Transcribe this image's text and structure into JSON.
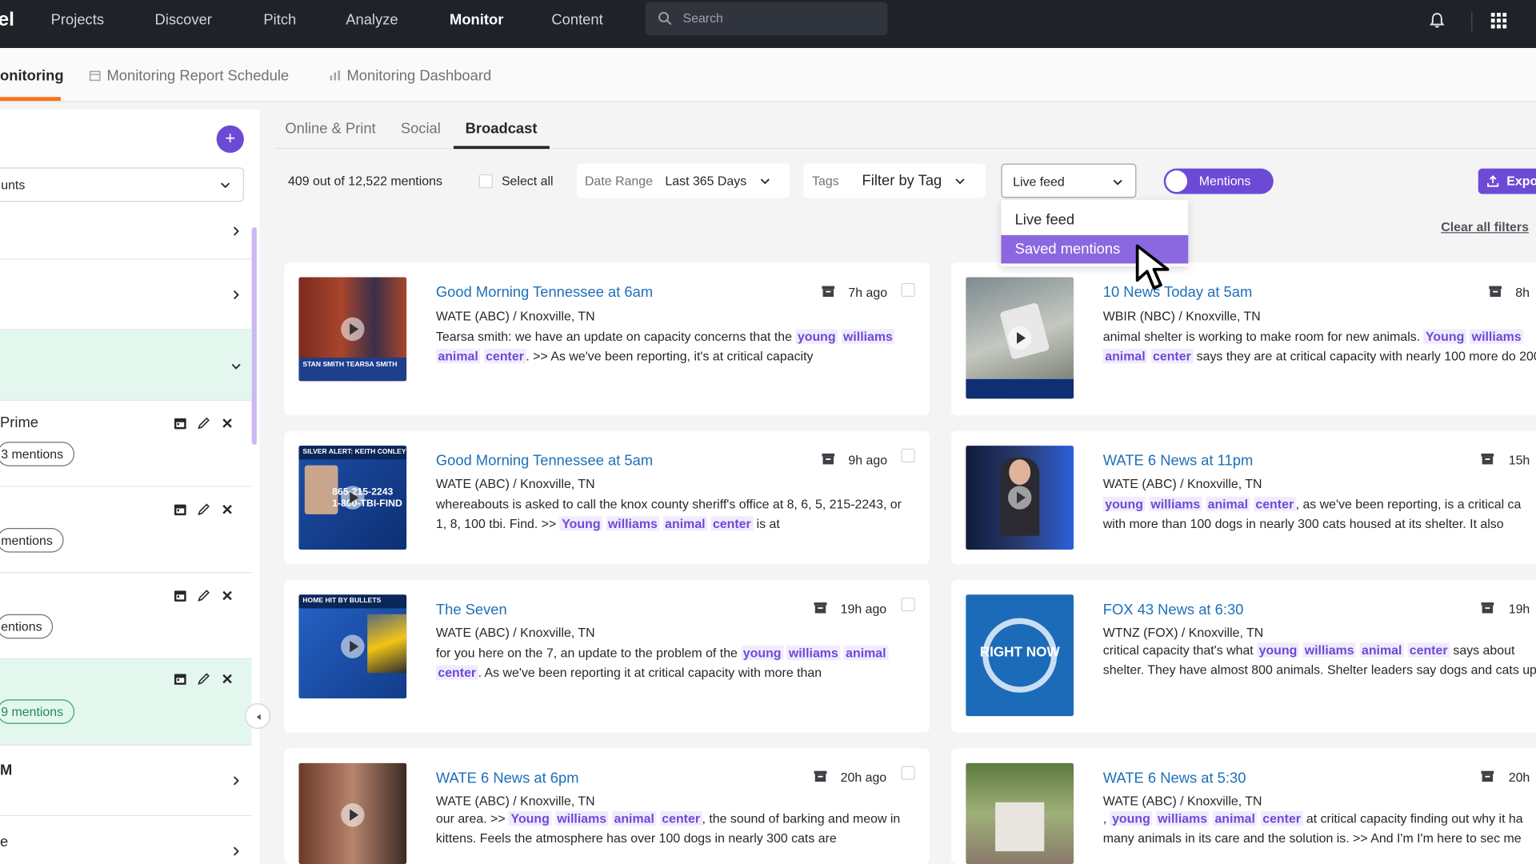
{
  "nav": {
    "logo": "el",
    "items": [
      "Projects",
      "Discover",
      "Pitch",
      "Analyze",
      "Monitor",
      "Content"
    ],
    "search_placeholder": "Search"
  },
  "subnav": {
    "tabs": [
      "onitoring",
      "Monitoring Report Schedule",
      "Monitoring Dashboard"
    ]
  },
  "sidebar": {
    "select_value": "unts",
    "row_prime": "Prime",
    "row_m": "M",
    "row_e": "e",
    "pills": [
      "3 mentions",
      "mentions",
      "entions",
      "9 mentions"
    ]
  },
  "content_tabs": [
    "Online & Print",
    "Social",
    "Broadcast"
  ],
  "filters": {
    "count": "409 out of 12,522 mentions",
    "select_all": "Select all",
    "date_label": "Date Range",
    "date_value": "Last 365 Days",
    "tags_label": "Tags",
    "tags_value": "Filter by Tag",
    "feed_value": "Live feed",
    "toggle_label": "Mentions",
    "export_label": "Expo",
    "clear": "Clear all filters"
  },
  "dropdown": {
    "options": [
      "Live feed",
      "Saved mentions"
    ],
    "selected": "Saved mentions"
  },
  "cards_left": [
    {
      "title": "Good Morning Tennessee at 6am",
      "time": "7h ago",
      "source": "WATE (ABC) / Knoxville, TN",
      "pre": "Tearsa smith: we have an update on capacity concerns that the ",
      "kw": [
        "young",
        "williams",
        "animal",
        "center"
      ],
      "post": ". >> As we've been reporting, it's at critical capacity",
      "thumb_caption": "STAN SMITH   TEARSA SMITH"
    },
    {
      "title": "Good Morning Tennessee at 5am",
      "time": "9h ago",
      "source": "WATE (ABC) / Knoxville, TN",
      "pre": "whereabouts is asked to call the knox county sheriff's office at 8, 6, 5, 215-2243, or 1, 8, 100 tbi. Find. >> ",
      "kw": [
        "Young",
        "williams",
        "animal",
        "center"
      ],
      "post": " is at",
      "thumb_caption": "SILVER ALERT: KEITH CONLEY",
      "thumb_number": "865-215-2243\n1-800-TBI-FIND"
    },
    {
      "title": "The Seven",
      "time": "19h ago",
      "source": "WATE (ABC) / Knoxville, TN",
      "pre": "for you here on the 7, an update to the problem of the ",
      "kw": [
        "young",
        "williams",
        "animal",
        "center"
      ],
      "post": ". As we've been reporting it at critical capacity with more than",
      "thumb_caption": "HOME HIT BY BULLETS"
    },
    {
      "title": "WATE 6 News at 6pm",
      "time": "20h ago",
      "source": "WATE (ABC) / Knoxville, TN",
      "pre": "our area. >> ",
      "kw": [
        "Young",
        "williams",
        "animal",
        "center"
      ],
      "post": ", the sound of barking and meow in kittens. Feels the atmosphere has over 100 dogs in nearly 300 cats are",
      "thumb_caption": ""
    }
  ],
  "cards_right": [
    {
      "title": "10 News Today at 5am",
      "time": "8h",
      "source": "WBIR (NBC) / Knoxville, TN",
      "pre": "animal shelter is working to make room for new animals. ",
      "kw": [
        "Young",
        "williams",
        "animal",
        "center"
      ],
      "post": " says they are at critical capacity with nearly 100 more do 200"
    },
    {
      "title": "WATE 6 News at 11pm",
      "time": "15h",
      "source": "WATE (ABC) / Knoxville, TN",
      "pre": "",
      "kw": [
        "young",
        "williams",
        "animal",
        "center"
      ],
      "post": ", as we've been reporting, is a critical ca with more than 100 dogs in nearly 300 cats housed at its shelter. It also"
    },
    {
      "title": "FOX 43 News at 6:30",
      "time": "19h",
      "source": "WTNZ (FOX) / Knoxville, TN",
      "pre": "critical capacity that's what ",
      "kw": [
        "young",
        "williams",
        "animal",
        "center"
      ],
      "post": " says about shelter. They have almost 800 animals. Shelter leaders say dogs and cats up",
      "thumb_text": "RIGHT NOW"
    },
    {
      "title": "WATE 6 News at 5:30",
      "time": "20h",
      "source": "WATE (ABC) / Knoxville, TN",
      "pre": ", ",
      "kw": [
        "young",
        "williams",
        "animal",
        "center"
      ],
      "post": " at critical capacity finding out why it ha many animals in its care and the solution is. >> And I'm I'm here to sec me"
    }
  ],
  "colors": {
    "accent": "#6d4ad6",
    "link": "#1d6fb8",
    "nav_bg": "#1f2229",
    "active_underline": "#f97316"
  }
}
